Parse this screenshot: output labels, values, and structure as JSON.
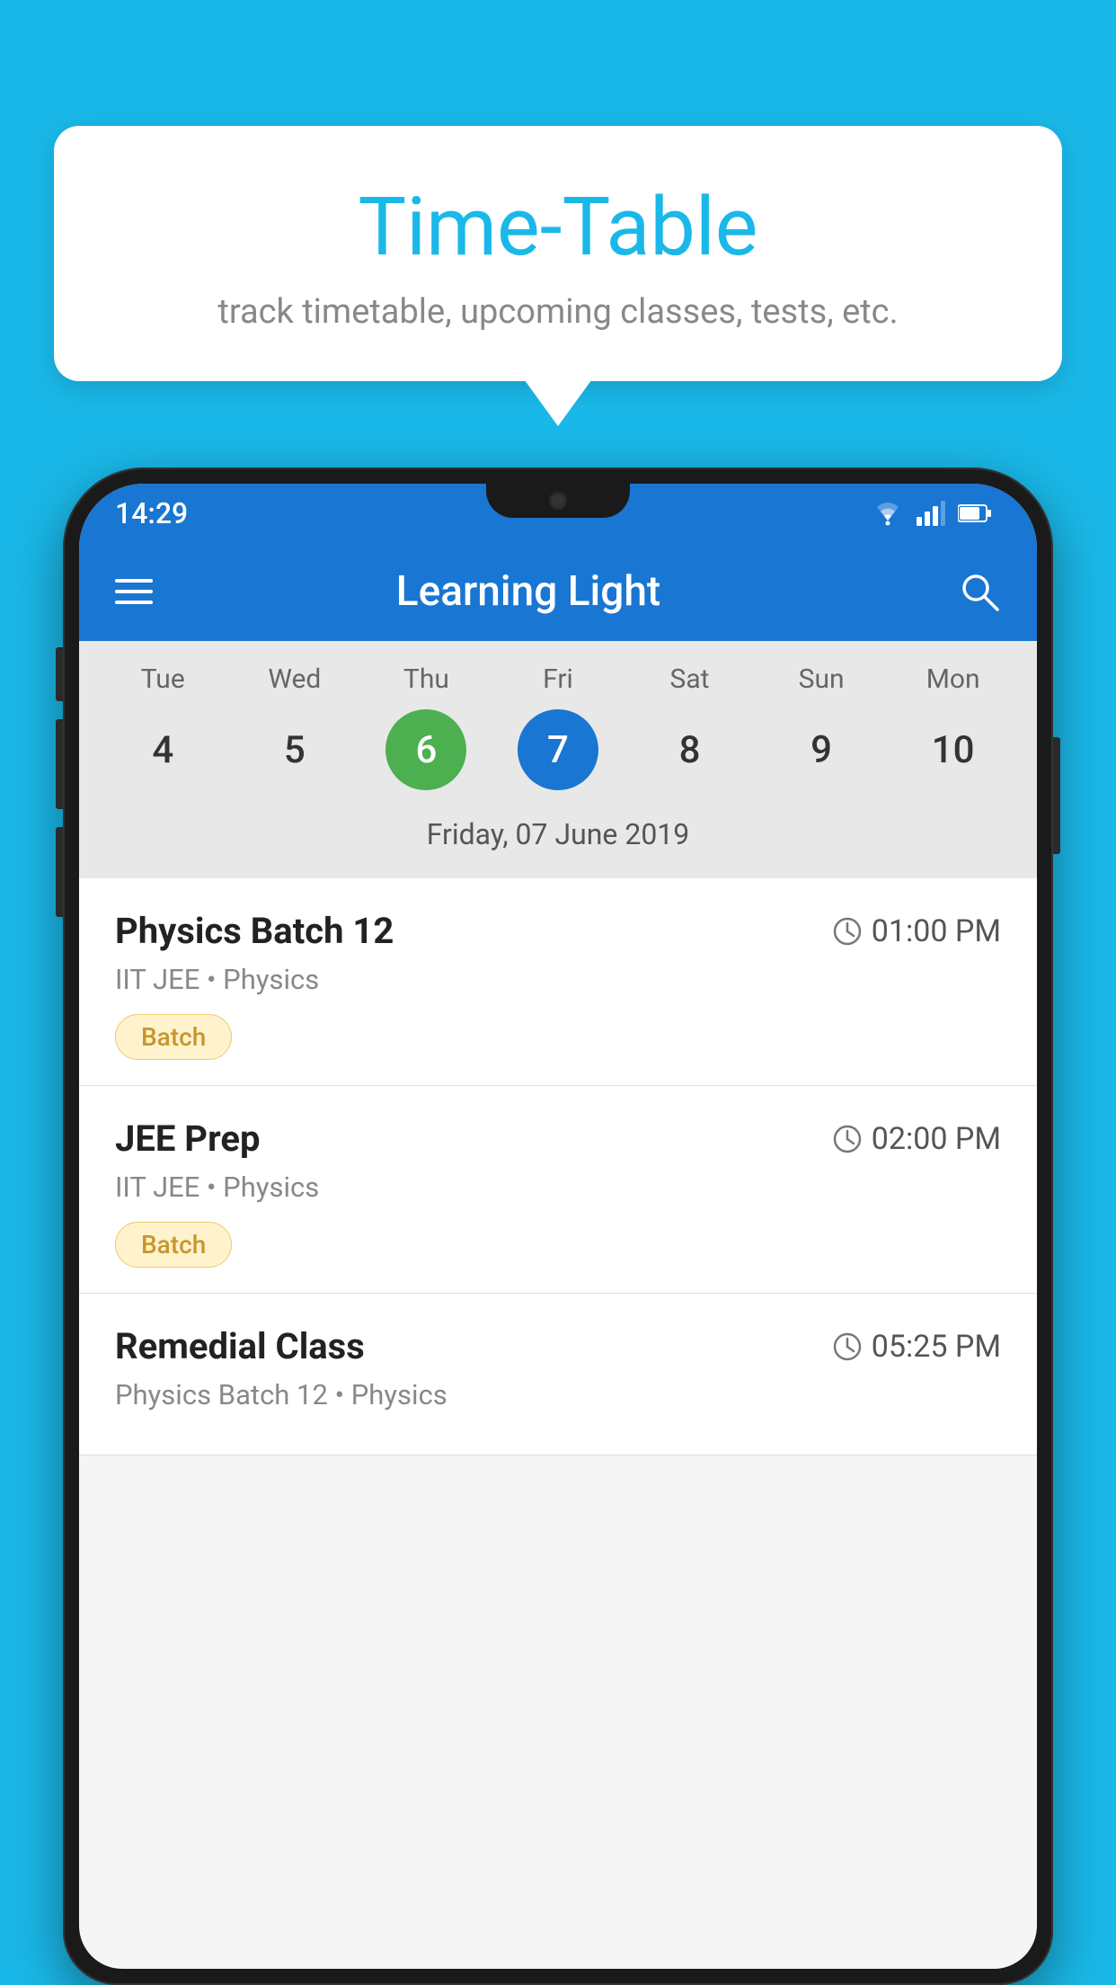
{
  "page": {
    "background_color": "#1ab8e8"
  },
  "speech_bubble": {
    "title": "Time-Table",
    "subtitle": "track timetable, upcoming classes, tests, etc."
  },
  "phone": {
    "status_bar": {
      "time": "14:29"
    },
    "app_bar": {
      "title": "Learning Light"
    },
    "calendar": {
      "days": [
        {
          "name": "Tue",
          "number": "4",
          "state": "normal"
        },
        {
          "name": "Wed",
          "number": "5",
          "state": "normal"
        },
        {
          "name": "Thu",
          "number": "6",
          "state": "today"
        },
        {
          "name": "Fri",
          "number": "7",
          "state": "selected"
        },
        {
          "name": "Sat",
          "number": "8",
          "state": "normal"
        },
        {
          "name": "Sun",
          "number": "9",
          "state": "normal"
        },
        {
          "name": "Mon",
          "number": "10",
          "state": "normal"
        }
      ],
      "selected_date_label": "Friday, 07 June 2019"
    },
    "schedule": {
      "items": [
        {
          "title": "Physics Batch 12",
          "time": "01:00 PM",
          "subtitle": "IIT JEE • Physics",
          "badge": "Batch"
        },
        {
          "title": "JEE Prep",
          "time": "02:00 PM",
          "subtitle": "IIT JEE • Physics",
          "badge": "Batch"
        },
        {
          "title": "Remedial Class",
          "time": "05:25 PM",
          "subtitle": "Physics Batch 12 • Physics",
          "badge": null
        }
      ]
    }
  }
}
